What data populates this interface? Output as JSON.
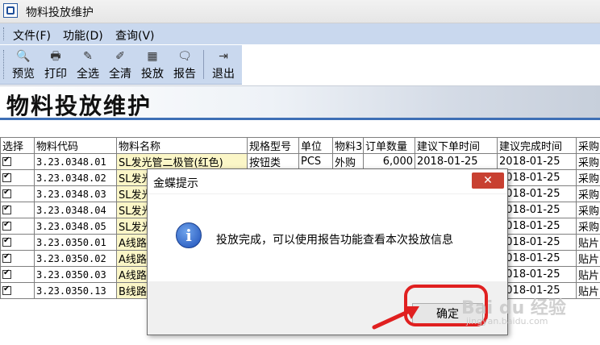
{
  "window": {
    "title": "物料投放维护"
  },
  "menu": [
    {
      "label": "文件(F)"
    },
    {
      "label": "功能(D)"
    },
    {
      "label": "查询(V)"
    }
  ],
  "toolbar": [
    {
      "label": "预览",
      "icon": "preview-icon"
    },
    {
      "label": "打印",
      "icon": "print-icon"
    },
    {
      "label": "全选",
      "icon": "select-all-icon"
    },
    {
      "label": "全清",
      "icon": "clear-all-icon"
    },
    {
      "label": "投放",
      "icon": "dispatch-icon"
    },
    {
      "label": "报告",
      "icon": "report-icon"
    },
    {
      "label": "退出",
      "icon": "exit-icon"
    }
  ],
  "heading": "物料投放维护",
  "table": {
    "columns": [
      "选择",
      "物料代码",
      "物料名称",
      "规格型号",
      "单位",
      "物料3",
      "订单数量",
      "建议下单时间",
      "建议完成时间",
      "采购"
    ],
    "rows": [
      {
        "code": "3.23.0348.01",
        "name": "SL发光管二极管(红色)",
        "spec": "按钮类",
        "unit": "PCS",
        "type": "外购",
        "qty": "6,000",
        "order_date": "2018-01-25",
        "finish_date": "2018-01-25",
        "buyer": "采购"
      },
      {
        "code": "3.23.0348.02",
        "name": "SL发光",
        "spec": "",
        "unit": "",
        "type": "",
        "qty": "",
        "order_date": "",
        "finish_date": "2018-01-25",
        "buyer": "采购"
      },
      {
        "code": "3.23.0348.03",
        "name": "SL发光",
        "spec": "",
        "unit": "",
        "type": "",
        "qty": "",
        "order_date": "",
        "finish_date": "2018-01-25",
        "buyer": "采购"
      },
      {
        "code": "3.23.0348.04",
        "name": "SL发光",
        "spec": "",
        "unit": "",
        "type": "",
        "qty": "",
        "order_date": "",
        "finish_date": "2018-01-25",
        "buyer": "采购"
      },
      {
        "code": "3.23.0348.05",
        "name": "SL发光",
        "spec": "",
        "unit": "",
        "type": "",
        "qty": "",
        "order_date": "",
        "finish_date": "2018-01-25",
        "buyer": "采购"
      },
      {
        "code": "3.23.0350.01",
        "name": "A线路",
        "spec": "",
        "unit": "",
        "type": "",
        "qty": "",
        "order_date": "",
        "finish_date": "2018-01-25",
        "buyer": "贴片"
      },
      {
        "code": "3.23.0350.02",
        "name": "A线路",
        "spec": "",
        "unit": "",
        "type": "",
        "qty": "",
        "order_date": "",
        "finish_date": "2018-01-25",
        "buyer": "贴片"
      },
      {
        "code": "3.23.0350.03",
        "name": "A线路",
        "spec": "",
        "unit": "",
        "type": "",
        "qty": "",
        "order_date": "",
        "finish_date": "2018-01-25",
        "buyer": "贴片"
      },
      {
        "code": "3.23.0350.13",
        "name": "B线路",
        "spec": "",
        "unit": "",
        "type": "",
        "qty": "",
        "order_date": "",
        "finish_date": "2018-01-25",
        "buyer": "贴片"
      }
    ]
  },
  "dialog": {
    "title": "金蝶提示",
    "close": "✕",
    "message": "投放完成，可以使用报告功能查看本次投放信息",
    "ok_label": "确定"
  },
  "watermark": {
    "main": "Bai du 经验",
    "sub": "jingyan.baidu.com"
  },
  "colors": {
    "menubar": "#c9d8ee",
    "accent_line": "#3e6fb5",
    "close_button": "#c84031",
    "highlight": "#e02020",
    "name_cell": "#fbf6c7"
  }
}
